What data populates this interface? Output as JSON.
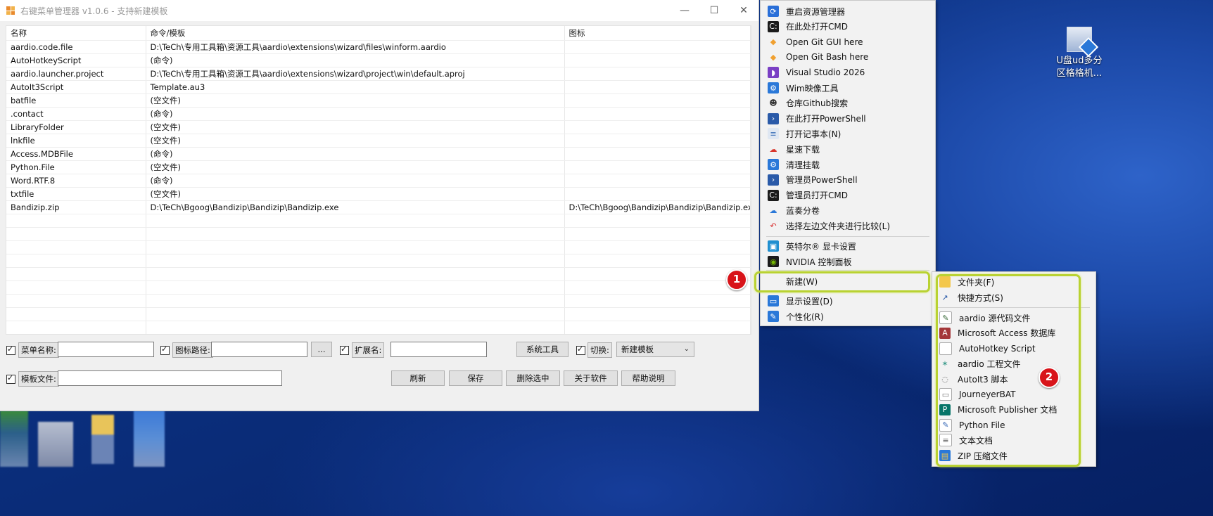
{
  "window": {
    "title": "右键菜单管理器 v1.0.6 - 支持新建模板"
  },
  "grid": {
    "columns": [
      "名称",
      "命令/模板",
      "图标"
    ],
    "rows": [
      [
        "aardio.code.file",
        "D:\\TeCh\\专用工具箱\\资源工具\\aardio\\extensions\\wizard\\files\\winform.aardio",
        ""
      ],
      [
        "AutoHotkeyScript",
        "(命令)",
        ""
      ],
      [
        "aardio.launcher.project",
        "D:\\TeCh\\专用工具箱\\资源工具\\aardio\\extensions\\wizard\\project\\win\\default.aproj",
        ""
      ],
      [
        "AutoIt3Script",
        "Template.au3",
        ""
      ],
      [
        "batfile",
        "(空文件)",
        ""
      ],
      [
        ".contact",
        "(命令)",
        ""
      ],
      [
        "LibraryFolder",
        "(空文件)",
        ""
      ],
      [
        "lnkfile",
        "(空文件)",
        ""
      ],
      [
        "Access.MDBFile",
        "(命令)",
        ""
      ],
      [
        "Python.File",
        "(空文件)",
        ""
      ],
      [
        "Word.RTF.8",
        "(命令)",
        ""
      ],
      [
        "txtfile",
        "(空文件)",
        ""
      ],
      [
        "Bandizip.zip",
        "D:\\TeCh\\Bgoog\\Bandizip\\Bandizip\\Bandizip.exe",
        "D:\\TeCh\\Bgoog\\Bandizip\\Bandizip\\Bandizip.exe"
      ]
    ],
    "empty_rows": 9
  },
  "controls": {
    "menu_name_label": "菜单名称:",
    "icon_path_label": "图标路径:",
    "browse_label": "...",
    "ext_label": "扩展名:",
    "system_tools": "系统工具",
    "switch_label": "切换:",
    "switch_value": "新建模板",
    "template_file_label": "模板文件:",
    "refresh": "刷新",
    "save": "保存",
    "delete_selected": "删除选中",
    "about": "关于软件",
    "help": "帮助说明"
  },
  "context_menu": {
    "items": [
      {
        "label": "重启资源管理器",
        "icon": "refresh-icon"
      },
      {
        "label": "在此处打开CMD",
        "icon": "cmd-icon"
      },
      {
        "label": "Open Git GUI here",
        "icon": "git-icon"
      },
      {
        "label": "Open Git Bash here",
        "icon": "git-icon"
      },
      {
        "label": "Visual Studio 2026",
        "icon": "visual-studio-icon"
      },
      {
        "label": "Wim映像工具",
        "icon": "gear-icon"
      },
      {
        "label": "仓库Github搜索",
        "icon": "github-icon"
      },
      {
        "label": "在此打开PowerShell",
        "icon": "powershell-icon"
      },
      {
        "label": "打开记事本(N)",
        "icon": "notepad-icon"
      },
      {
        "label": "星速下载",
        "icon": "cloud-download-icon"
      },
      {
        "label": "清理挂载",
        "icon": "gear-icon"
      },
      {
        "label": "管理员PowerShell",
        "icon": "powershell-icon"
      },
      {
        "label": "管理员打开CMD",
        "icon": "cmd-icon"
      },
      {
        "label": "蓝奏分卷",
        "icon": "cloud-icon"
      },
      {
        "label": "选择左边文件夹进行比较(L)",
        "icon": "undo-icon"
      }
    ],
    "items2": [
      {
        "label": "英特尔® 显卡设置",
        "icon": "intel-graphics-icon"
      },
      {
        "label": "NVIDIA 控制面板",
        "icon": "nvidia-icon"
      }
    ],
    "new_item": "新建(W)",
    "items3": [
      {
        "label": "显示设置(D)",
        "icon": "display-icon"
      },
      {
        "label": "个性化(R)",
        "icon": "personalize-icon"
      }
    ]
  },
  "submenu": {
    "items_top": [
      {
        "label": "文件夹(F)",
        "icon": "folder-icon"
      },
      {
        "label": "快捷方式(S)",
        "icon": "shortcut-icon"
      }
    ],
    "items": [
      {
        "label": "aardio 源代码文件",
        "icon": "aardio-file-icon"
      },
      {
        "label": "Microsoft Access 数据库",
        "icon": "access-icon"
      },
      {
        "label": "AutoHotkey Script",
        "icon": "blank-file-icon"
      },
      {
        "label": "aardio 工程文件",
        "icon": "aardio-project-icon"
      },
      {
        "label": "AutoIt3 脚本",
        "icon": "autoit-icon"
      },
      {
        "label": "JourneyerBAT",
        "icon": "bat-file-icon"
      },
      {
        "label": "Microsoft Publisher 文档",
        "icon": "publisher-icon"
      },
      {
        "label": "Python File",
        "icon": "python-icon"
      },
      {
        "label": "文本文档",
        "icon": "text-file-icon"
      },
      {
        "label": "ZIP 压缩文件",
        "icon": "zip-icon"
      }
    ]
  },
  "annotations": {
    "badge1": "1",
    "badge2": "2"
  },
  "desktop": {
    "icon_label_line1": "U盘ud多分",
    "icon_label_line2": "区格格机..."
  }
}
